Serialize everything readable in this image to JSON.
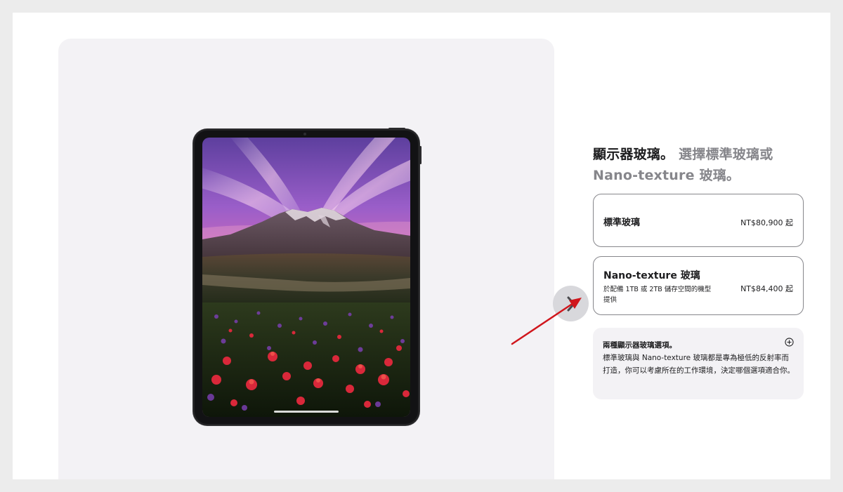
{
  "heading": {
    "bold": "顯示器玻璃。",
    "sub_line1": "選擇標準玻璃或",
    "sub_line2": "Nano-texture 玻璃。"
  },
  "options": [
    {
      "title": "標準玻璃",
      "price": "NT$80,900 起",
      "note": ""
    },
    {
      "title": "Nano-texture 玻璃",
      "price": "NT$84,400 起",
      "note": "於配備 1TB 或 2TB 儲存空間的機型提供"
    }
  ],
  "info": {
    "title": "兩種顯示器玻璃選項。",
    "body": "標準玻璃與 Nano-texture 玻璃都是專為極低的反射率而打造，你可以考慮所在的工作環境，決定哪個選項適合你。"
  },
  "icons": {
    "next": "chevron-right-icon",
    "expand": "plus-circle-icon",
    "annotation": "red-arrow"
  },
  "colors": {
    "annotation": "#d0161c",
    "option_border": "#86868b",
    "panel_bg": "#f3f2f5",
    "heading_sub": "#86868b"
  }
}
